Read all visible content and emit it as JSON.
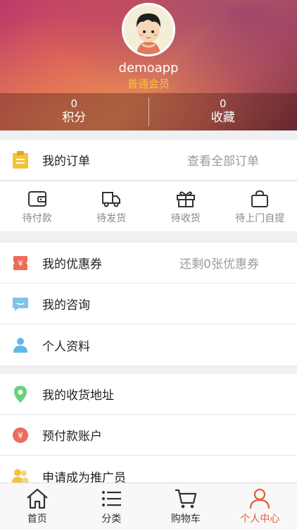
{
  "profile": {
    "username": "demoapp",
    "level": "普通会员"
  },
  "stats": [
    {
      "value": "0",
      "label": "积分"
    },
    {
      "value": "0",
      "label": "收藏"
    }
  ],
  "orders": {
    "title": "我的订单",
    "view_all": "查看全部订单",
    "states": [
      {
        "label": "待付款",
        "icon": "wallet-icon"
      },
      {
        "label": "待发货",
        "icon": "truck-icon"
      },
      {
        "label": "待收货",
        "icon": "gift-box-icon"
      },
      {
        "label": "待上门自提",
        "icon": "shopping-bag-icon"
      }
    ]
  },
  "group2": [
    {
      "label": "我的优惠券",
      "extra": "还剩0张优惠券",
      "icon": "coupon-icon"
    },
    {
      "label": "我的咨询",
      "icon": "chat-icon"
    },
    {
      "label": "个人资料",
      "icon": "person-icon"
    }
  ],
  "group3": [
    {
      "label": "我的收货地址",
      "icon": "location-pin-icon"
    },
    {
      "label": "预付款账户",
      "icon": "yen-coin-icon"
    },
    {
      "label": "申请成为推广员",
      "icon": "promoter-icon"
    }
  ],
  "tabbar": [
    {
      "label": "首页",
      "icon": "home-icon",
      "active": false
    },
    {
      "label": "分类",
      "icon": "list-icon",
      "active": false
    },
    {
      "label": "购物车",
      "icon": "cart-icon",
      "active": false
    },
    {
      "label": "个人中心",
      "icon": "user-icon",
      "active": true
    }
  ],
  "colors": {
    "accent": "#e45b35",
    "level": "#f6c235",
    "muted": "#9a9a9a"
  }
}
